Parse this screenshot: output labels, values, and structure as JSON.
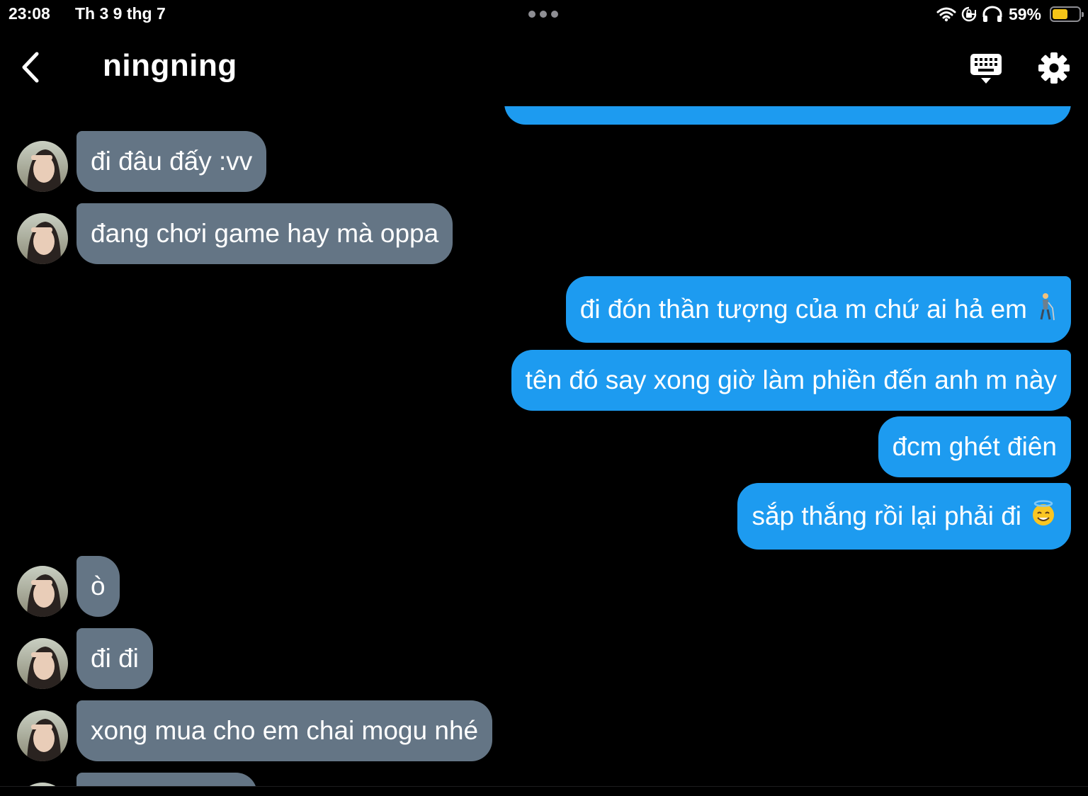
{
  "status_bar": {
    "time": "23:08",
    "date": "Th 3 9 thg 7",
    "battery_percent": "59%",
    "battery_level": 0.59,
    "icons": [
      "multitask-dots-icon",
      "wifi-icon",
      "orientation-lock-icon",
      "headphones-icon",
      "battery-icon"
    ]
  },
  "header": {
    "title": "ningning",
    "back_icon": "chevron-left-icon",
    "keyboard_icon": "keyboard-dismiss-icon",
    "settings_icon": "gear-icon"
  },
  "colors": {
    "background": "#000000",
    "incoming_bubble": "#647585",
    "outgoing_bubble": "#1d9bf0",
    "text": "#ffffff"
  },
  "messages": [
    {
      "direction": "out",
      "text": ""
    },
    {
      "direction": "in",
      "text": "đi đâu đấy :vv"
    },
    {
      "direction": "in",
      "text": "đang chơi game hay mà oppa"
    },
    {
      "direction": "out",
      "text": "đi đón thần tượng của m chứ ai hả em",
      "emoji": "person-with-cane-emoji"
    },
    {
      "direction": "out",
      "text": "tên đó say xong giờ làm phiền đến anh m này"
    },
    {
      "direction": "out",
      "text": "đcm ghét điên"
    },
    {
      "direction": "out",
      "text": "sắp thắng rồi lại phải đi",
      "emoji": "smiling-face-with-halo-emoji"
    },
    {
      "direction": "in",
      "text": "ò"
    },
    {
      "direction": "in",
      "text": "đi đi"
    },
    {
      "direction": "in",
      "text": "xong mua cho em chai mogu nhé"
    },
    {
      "direction": "in",
      "text": ""
    }
  ]
}
